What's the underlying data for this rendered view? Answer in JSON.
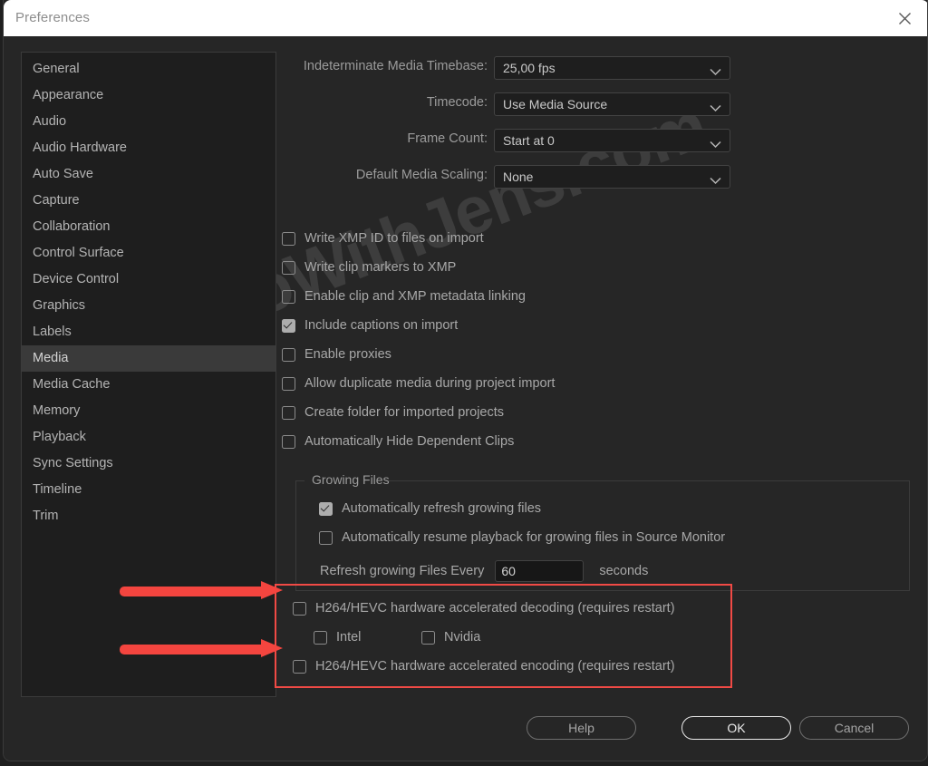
{
  "window": {
    "title": "Preferences",
    "close_icon": "close-icon"
  },
  "watermark": {
    "text": "VideoWithJens.com"
  },
  "sidebar": {
    "items": [
      {
        "label": "General",
        "selected": false
      },
      {
        "label": "Appearance",
        "selected": false
      },
      {
        "label": "Audio",
        "selected": false
      },
      {
        "label": "Audio Hardware",
        "selected": false
      },
      {
        "label": "Auto Save",
        "selected": false
      },
      {
        "label": "Capture",
        "selected": false
      },
      {
        "label": "Collaboration",
        "selected": false
      },
      {
        "label": "Control Surface",
        "selected": false
      },
      {
        "label": "Device Control",
        "selected": false
      },
      {
        "label": "Graphics",
        "selected": false
      },
      {
        "label": "Labels",
        "selected": false
      },
      {
        "label": "Media",
        "selected": true
      },
      {
        "label": "Media Cache",
        "selected": false
      },
      {
        "label": "Memory",
        "selected": false
      },
      {
        "label": "Playback",
        "selected": false
      },
      {
        "label": "Sync Settings",
        "selected": false
      },
      {
        "label": "Timeline",
        "selected": false
      },
      {
        "label": "Trim",
        "selected": false
      }
    ]
  },
  "media_panel": {
    "selects": [
      {
        "label": "Indeterminate Media Timebase:",
        "value": "25,00 fps"
      },
      {
        "label": "Timecode:",
        "value": "Use Media Source"
      },
      {
        "label": "Frame Count:",
        "value": "Start at 0"
      },
      {
        "label": "Default Media Scaling:",
        "value": "None"
      }
    ],
    "checkboxes": [
      {
        "label": "Write XMP ID to files on import",
        "checked": false
      },
      {
        "label": "Write clip markers to XMP",
        "checked": false
      },
      {
        "label": "Enable clip and XMP metadata linking",
        "checked": false
      },
      {
        "label": "Include captions on import",
        "checked": true
      },
      {
        "label": "Enable proxies",
        "checked": false
      },
      {
        "label": "Allow duplicate media during project import",
        "checked": false
      },
      {
        "label": "Create folder for imported projects",
        "checked": false
      },
      {
        "label": "Automatically Hide Dependent Clips",
        "checked": false
      }
    ],
    "growing_files": {
      "title": "Growing Files",
      "checkboxes": [
        {
          "label": "Automatically refresh growing files",
          "checked": true
        },
        {
          "label": "Automatically resume playback for growing files in Source Monitor",
          "checked": false
        }
      ],
      "refresh_label": "Refresh growing Files Every",
      "refresh_value": "60",
      "refresh_unit": "seconds"
    },
    "hardware": {
      "decoding": {
        "label": "H264/HEVC hardware accelerated decoding (requires restart)",
        "checked": false
      },
      "vendors": [
        {
          "label": "Intel",
          "checked": false
        },
        {
          "label": "Nvidia",
          "checked": false
        }
      ],
      "encoding": {
        "label": "H264/HEVC hardware accelerated encoding (requires restart)",
        "checked": false
      },
      "highlight_color": "#f04a45"
    }
  },
  "footer": {
    "help": "Help",
    "ok": "OK",
    "cancel": "Cancel"
  }
}
